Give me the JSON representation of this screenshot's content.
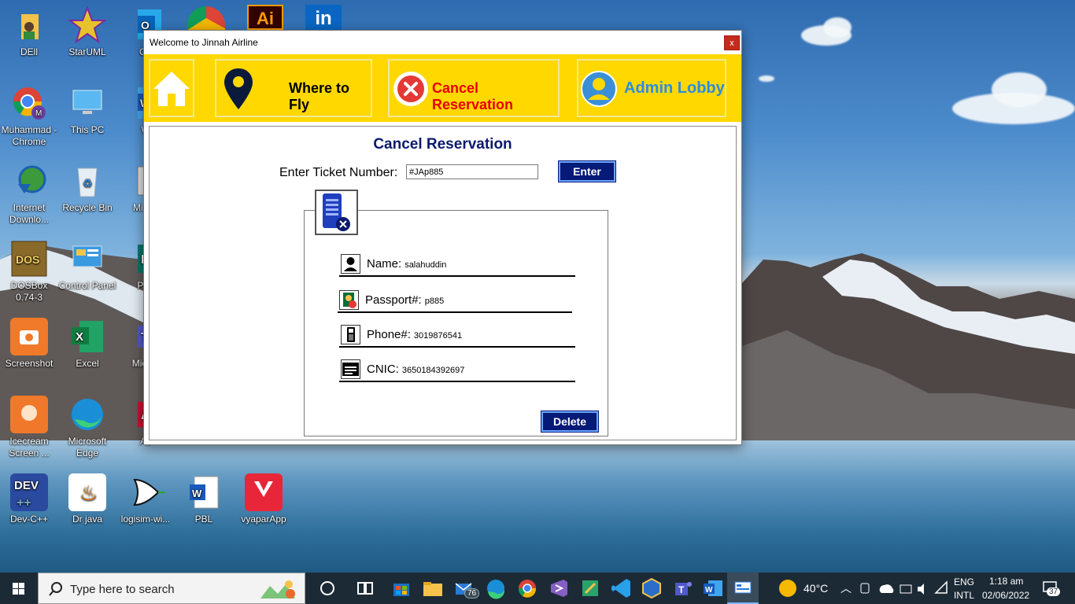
{
  "desktop": {
    "icons": [
      {
        "label": "DEll",
        "icon": "folder-user-icon"
      },
      {
        "label": "StarUML",
        "icon": "staruml-icon"
      },
      {
        "label": "Ou",
        "icon": "outlook-icon"
      },
      {
        "label": "Muhammad - Chrome",
        "icon": "chrome-profile-icon"
      },
      {
        "label": "This PC",
        "icon": "computer-icon"
      },
      {
        "label": "W",
        "icon": "word-icon"
      },
      {
        "label": "Internet Downlo...",
        "icon": "idm-icon"
      },
      {
        "label": "Recycle Bin",
        "icon": "recycle-bin-icon"
      },
      {
        "label": "Mi Ins",
        "icon": "installer-icon"
      },
      {
        "label": "DOSBox 0.74-3",
        "icon": "dosbox-icon"
      },
      {
        "label": "Control Panel",
        "icon": "control-panel-icon"
      },
      {
        "label": "Pub",
        "icon": "publisher-icon"
      },
      {
        "label": "Screenshot",
        "icon": "screenshot-icon"
      },
      {
        "label": "Excel",
        "icon": "excel-icon"
      },
      {
        "label": "Mic Te",
        "icon": "teams-icon"
      },
      {
        "label": "Icecream Screen ...",
        "icon": "icecream-icon"
      },
      {
        "label": "Microsoft Edge",
        "icon": "edge-icon"
      },
      {
        "label": "Ac",
        "icon": "acrobat-icon"
      },
      {
        "label": "Dev-C++",
        "icon": "devcpp-icon"
      },
      {
        "label": "Dr java",
        "icon": "java-icon"
      },
      {
        "label": "logisim-wi...",
        "icon": "logisim-icon"
      },
      {
        "label": "PBL",
        "icon": "word-doc-icon"
      },
      {
        "label": "vyaparApp",
        "icon": "vyapar-icon"
      }
    ],
    "top_icon_labels": [
      "Ai",
      "in"
    ]
  },
  "window": {
    "title": "Welcome to Jinnah Airline",
    "close_glyph": "x",
    "nav": {
      "home_icon": "home-icon",
      "where_to_fly": "Where to Fly",
      "cancel_reservation": "Cancel Reservation",
      "admin_lobby": "Admin Lobby"
    },
    "heading": "Cancel Reservation",
    "ticket_label": "Enter Ticket Number:",
    "ticket_value": "#JAp885",
    "enter_label": "Enter",
    "fields": [
      {
        "label": "Name:",
        "value": "salahuddin",
        "icon": "user-icon"
      },
      {
        "label": "Passport#:",
        "value": "p885",
        "icon": "passport-icon"
      },
      {
        "label": "Phone#:",
        "value": "3019876541",
        "icon": "phone-icon"
      },
      {
        "label": "CNIC:",
        "value": "3650184392697",
        "icon": "id-card-icon"
      }
    ],
    "delete_label": "Delete"
  },
  "taskbar": {
    "search_placeholder": "Type here to search",
    "mail_badge": "76",
    "weather": "40°C",
    "lang_top": "ENG",
    "lang_bottom": "INTL",
    "time": "1:18 am",
    "date": "02/06/2022",
    "notification_count": "37"
  }
}
